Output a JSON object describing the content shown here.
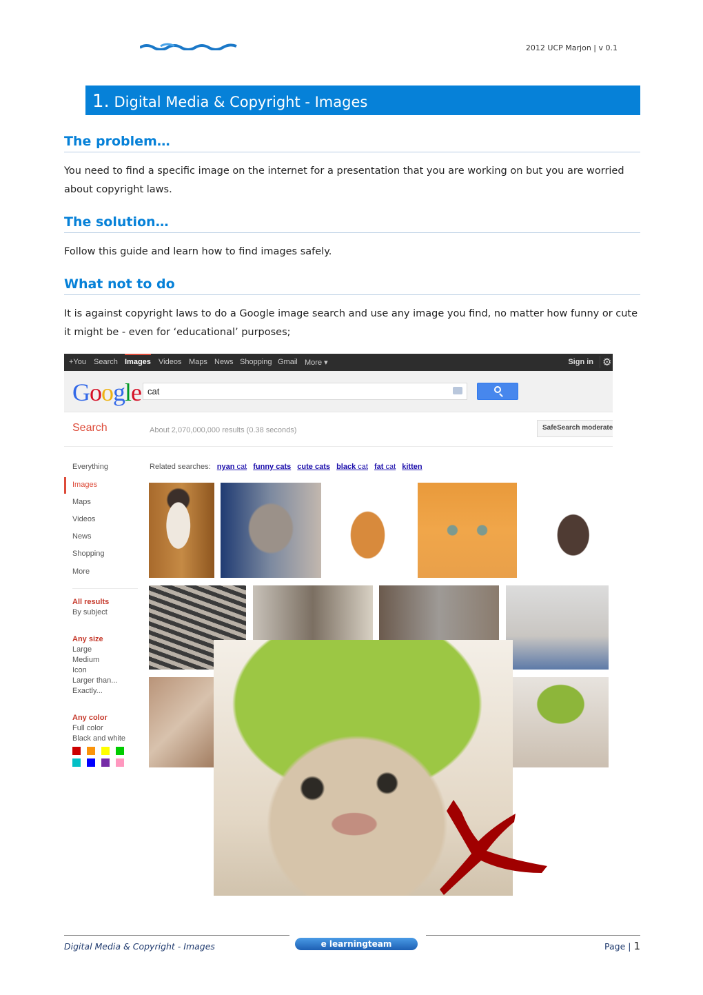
{
  "header": {
    "logo_alt": "wavy blue header logo",
    "doc_info": "2012 UCP Marjon | v 0.1"
  },
  "title": {
    "number": "1.",
    "text": "Digital Media & Copyright - Images"
  },
  "sections": [
    {
      "heading": "The problem…",
      "body": "You need to find a specific image on the internet for a presentation that you are working on but you are worried about copyright laws."
    },
    {
      "heading": "The solution…",
      "body": "Follow this guide and learn how to find images safely."
    },
    {
      "heading": "What not to do",
      "body": "It is against copyright laws to do a Google image search and use any image you find, no matter how funny or cute it might be - even for ‘educational’ purposes;"
    }
  ],
  "google": {
    "topbar": {
      "items": [
        "+You",
        "Search",
        "Images",
        "Videos",
        "Maps",
        "News",
        "Shopping",
        "Gmail",
        "More ▾"
      ],
      "active": "Images",
      "sign_in": "Sign in"
    },
    "logo": "Google",
    "query": "cat",
    "search_label": "Search",
    "stats": "About 2,070,000,000 results (0.38 seconds)",
    "safesearch": "SafeSearch moderate",
    "nav": [
      "Everything",
      "Images",
      "Maps",
      "Videos",
      "News",
      "Shopping",
      "More"
    ],
    "nav_active": "Images",
    "filters": {
      "results": {
        "heading": "All results",
        "items": [
          "By subject"
        ]
      },
      "size": {
        "heading": "Any size",
        "items": [
          "Large",
          "Medium",
          "Icon",
          "Larger than...",
          "Exactly..."
        ]
      },
      "color": {
        "heading": "Any color",
        "items": [
          "Full color",
          "Black and white"
        ]
      },
      "swatches": [
        "#cc0000",
        "#fb940b",
        "#ffff00",
        "#00cc00",
        "#03c0c6",
        "#0000ff",
        "#762ca7",
        "#ff98bf"
      ]
    },
    "related_label": "Related searches:",
    "related": [
      {
        "bold": "nyan",
        "rest": " cat"
      },
      {
        "bold": "funny cats",
        "rest": ""
      },
      {
        "bold": "cute cats",
        "rest": ""
      },
      {
        "bold": "black",
        "rest": " cat"
      },
      {
        "bold": "fat",
        "rest": " cat"
      },
      {
        "bold": "kitten",
        "rest": ""
      }
    ]
  },
  "overlay": {
    "image_alt": "cat wearing a lime-peel helmet",
    "mark": "X"
  },
  "footer": {
    "left": "Digital Media & Copyright - Images",
    "logo_text": "e learningteam",
    "page_label": "Page |",
    "page_number": "1"
  }
}
